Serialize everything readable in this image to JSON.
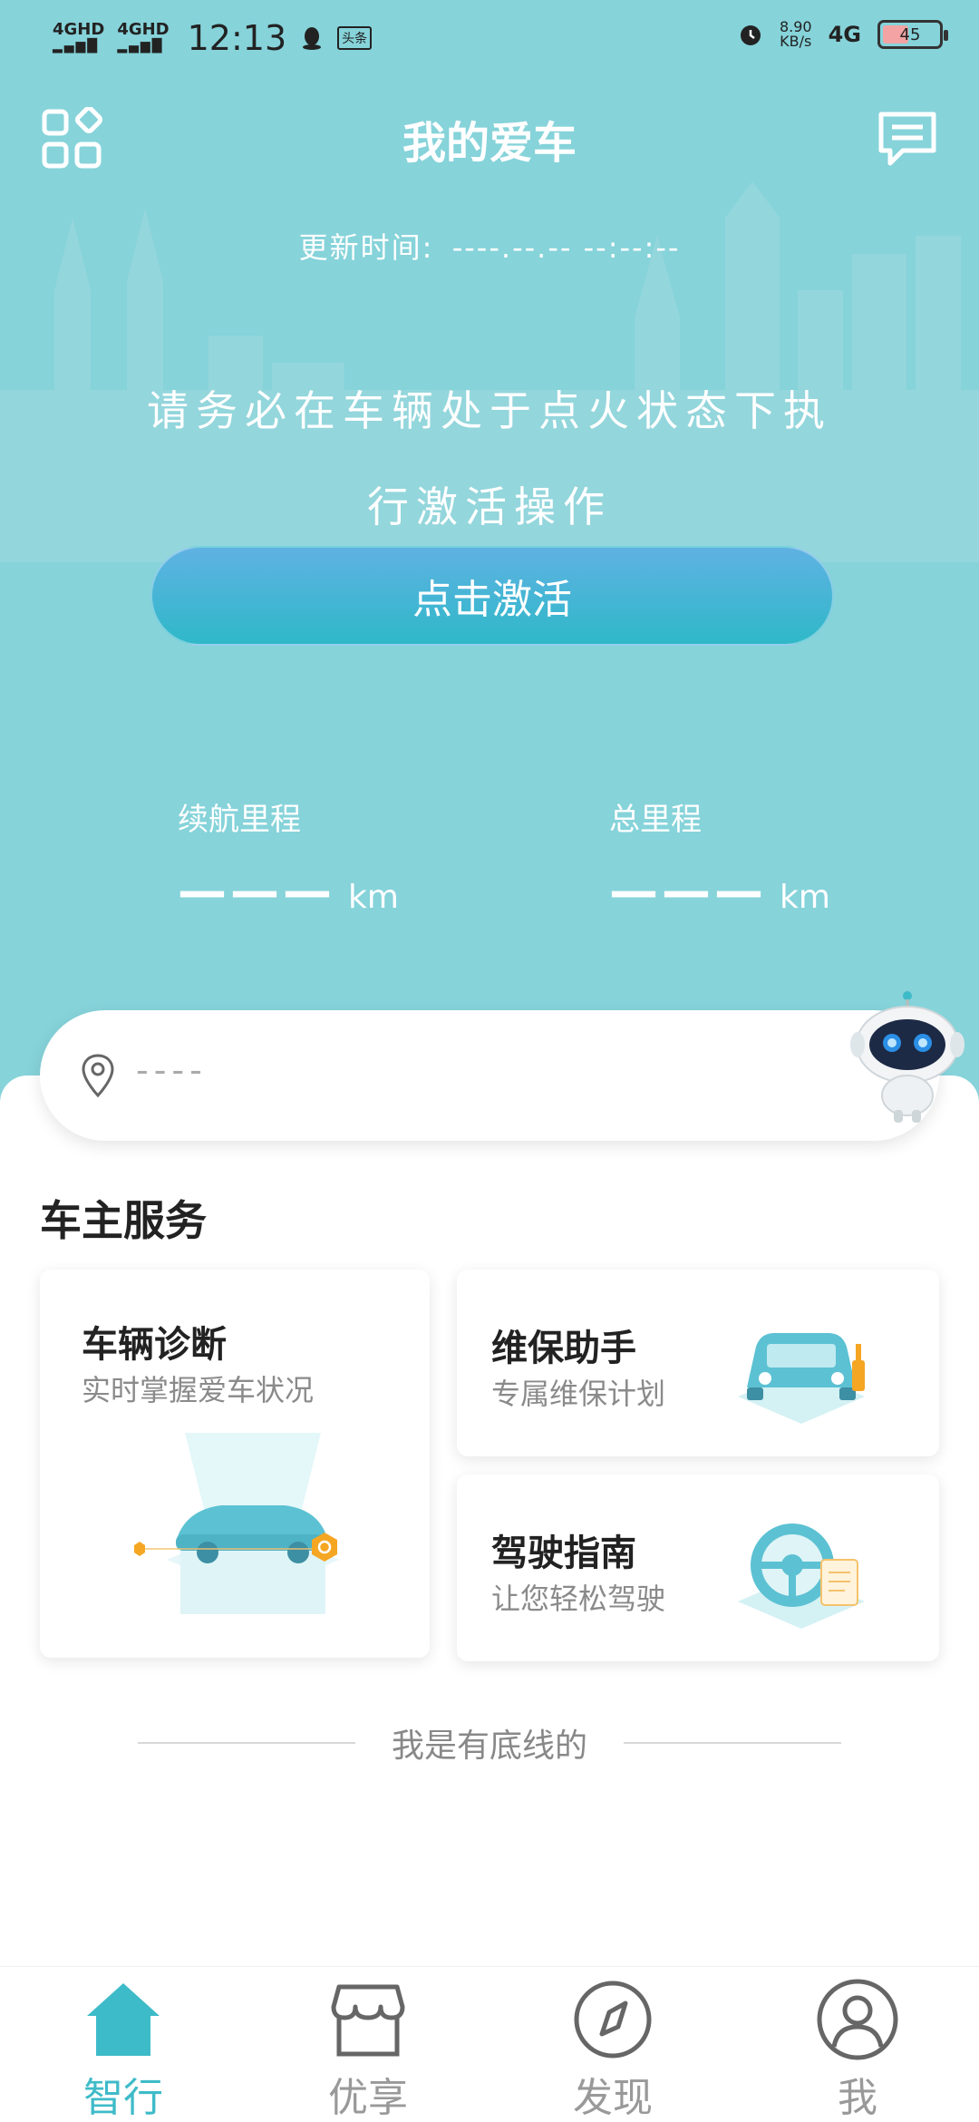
{
  "status_bar": {
    "signal1": "4GHD",
    "signal2": "4GHD",
    "time": "12:13",
    "app_badge": "头条",
    "net_speed_value": "8.90",
    "net_speed_unit": "KB/s",
    "network": "4G",
    "battery": "45"
  },
  "header": {
    "title": "我的爱车",
    "update_label": "更新时间:",
    "update_value": "----.--.-- --:--:--"
  },
  "hero": {
    "notice": "请务必在车辆处于点火状态下执行激活操作",
    "activate_button": "点击激活",
    "range_label": "续航里程",
    "range_value": "———",
    "range_unit": "km",
    "total_label": "总里程",
    "total_value": "———",
    "total_unit": "km"
  },
  "location": {
    "text": "----"
  },
  "services": {
    "section_title": "车主服务",
    "diagnosis": {
      "title": "车辆诊断",
      "subtitle": "实时掌握爱车状况"
    },
    "maintenance": {
      "title": "维保助手",
      "subtitle": "专属维保计划"
    },
    "guide": {
      "title": "驾驶指南",
      "subtitle": "让您轻松驾驶"
    }
  },
  "footer_note": "我是有底线的",
  "tabs": [
    {
      "label": "智行",
      "icon": "home-icon",
      "active": true
    },
    {
      "label": "优享",
      "icon": "store-icon",
      "active": false
    },
    {
      "label": "发现",
      "icon": "compass-icon",
      "active": false
    },
    {
      "label": "我",
      "icon": "user-icon",
      "active": false
    }
  ],
  "colors": {
    "hero_bg": "#86d3da",
    "accent": "#3ebbc8",
    "button_gradient_top": "#5fb2e3",
    "button_gradient_bottom": "#2fb8c8"
  }
}
